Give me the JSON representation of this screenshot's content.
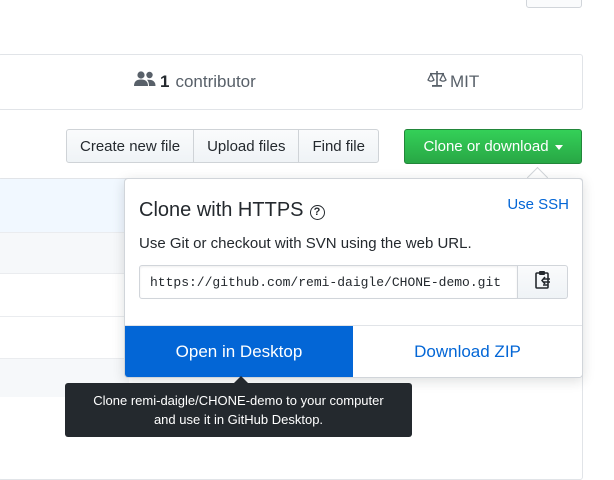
{
  "summary": {
    "contributors_count": "1",
    "contributors_label": "contributor",
    "contributors_icon": "people-icon",
    "license_label": "MIT",
    "license_icon": "law-icon"
  },
  "toolbar": {
    "create_new_file": "Create new file",
    "upload_files": "Upload files",
    "find_file": "Find file",
    "clone_or_download": "Clone or download"
  },
  "clone_panel": {
    "title": "Clone with HTTPS",
    "help_icon": "question-icon",
    "help_glyph": "?",
    "use_ssh": "Use SSH",
    "description": "Use Git or checkout with SVN using the web URL.",
    "url": "https://github.com/remi-daigle/CHONE-demo.git",
    "copy_icon": "clipboard-icon",
    "open_in_desktop": "Open in Desktop",
    "download_zip": "Download ZIP"
  },
  "tooltip": {
    "line1": "Clone remi-daigle/CHONE-demo to your computer",
    "line2": "and use it in GitHub Desktop."
  },
  "colors": {
    "green": "#28a745",
    "blue": "#0366d6",
    "tooltip_bg": "#24292e"
  }
}
